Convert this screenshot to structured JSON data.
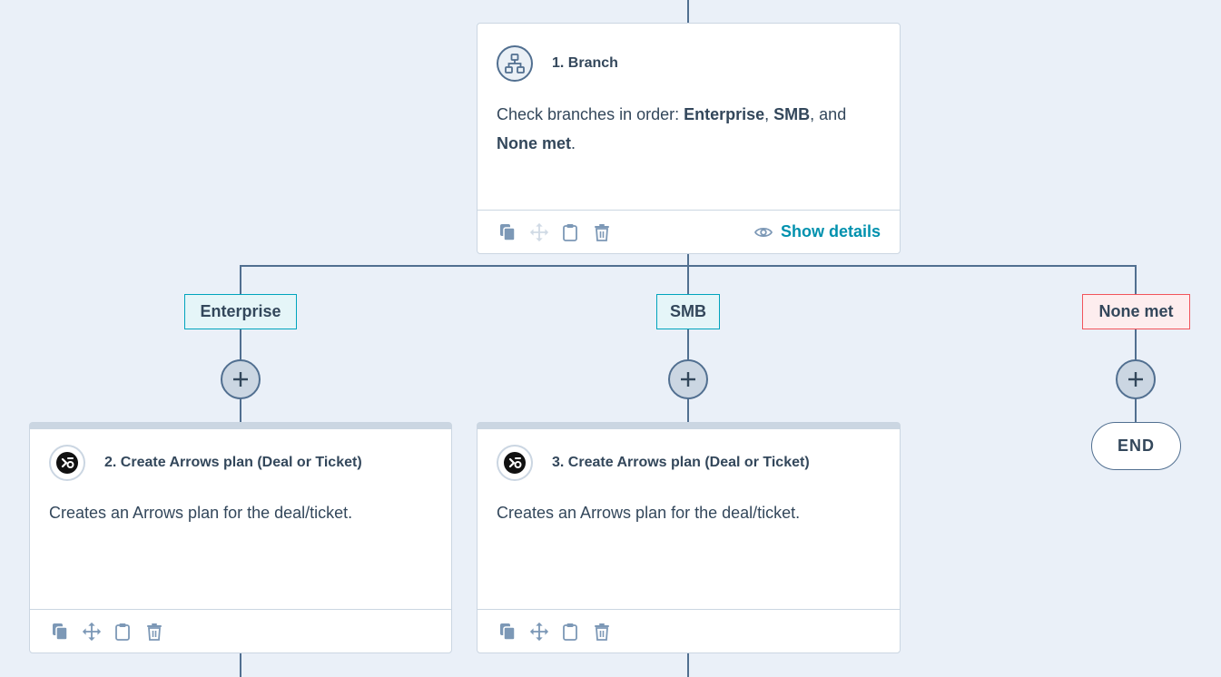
{
  "branch_card": {
    "title": "1. Branch",
    "description_prefix": "Check branches in order: ",
    "branch_1": "Enterprise",
    "sep_1": ", ",
    "branch_2": "SMB",
    "sep_2": ", and ",
    "branch_3": "None met",
    "suffix": ".",
    "show_details_label": "Show details",
    "icon": "branch-icon"
  },
  "branches": [
    {
      "label": "Enterprise",
      "type": "condition"
    },
    {
      "label": "SMB",
      "type": "condition"
    },
    {
      "label": "None met",
      "type": "fallback"
    }
  ],
  "action_cards": [
    {
      "title": "2. Create Arrows plan (Deal or Ticket)",
      "description": "Creates an Arrows plan for the deal/ticket.",
      "icon": "arrows-app-icon"
    },
    {
      "title": "3. Create Arrows plan (Deal or Ticket)",
      "description": "Creates an Arrows plan for the deal/ticket.",
      "icon": "arrows-app-icon"
    }
  ],
  "end_node": {
    "label": "END"
  },
  "toolbar_icons": [
    "copy-icon",
    "move-icon",
    "clipboard-icon",
    "trash-icon"
  ],
  "colors": {
    "canvas_bg": "#eaf0f8",
    "connector": "#516f90",
    "accent_link": "#0091ae",
    "condition_border": "#00a4bd",
    "condition_bg": "#e5f5f8",
    "fallback_border": "#f2545b",
    "fallback_bg": "#fdedee",
    "text": "#33475b"
  }
}
